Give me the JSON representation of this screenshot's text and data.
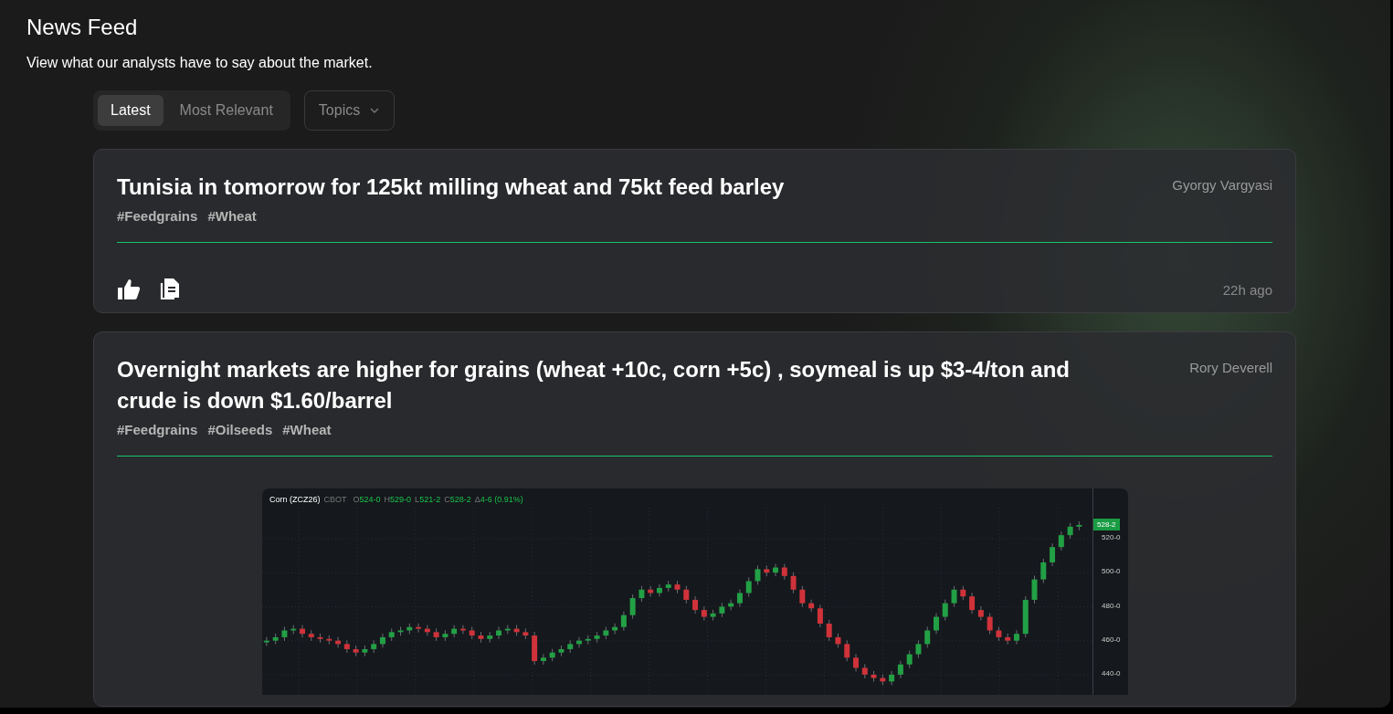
{
  "header": {
    "title": "News Feed",
    "subtitle": "View what our analysts have to say about the market."
  },
  "tabs": [
    {
      "label": "Latest",
      "selected": true
    },
    {
      "label": "Most Relevant",
      "selected": false
    }
  ],
  "topics_dropdown": {
    "label": "Topics"
  },
  "posts": [
    {
      "title": "Tunisia in tomorrow for 125kt milling wheat and 75kt feed barley",
      "author": "Gyorgy Vargyasi",
      "tags": [
        "#Feedgrains",
        "#Wheat"
      ],
      "time": "22h ago"
    },
    {
      "title": "Overnight markets are higher for grains (wheat +10c, corn +5c) , soymeal is up $3-4/ton and crude is down $1.60/barrel",
      "author": "Rory Deverell",
      "tags": [
        "#Feedgrains",
        "#Oilseeds",
        "#Wheat"
      ],
      "chart_image": {
        "symbol": "Corn (ZCZ26)",
        "exchange": "CBOT",
        "stats": [
          {
            "label": "O",
            "value": "524-0"
          },
          {
            "label": "H",
            "value": "529-0"
          },
          {
            "label": "L",
            "value": "521-2"
          },
          {
            "label": "C",
            "value": "528-2"
          },
          {
            "label": "Δ",
            "value": "4-6 (0.91%)"
          }
        ],
        "price_tag": "528-2",
        "axis_labels": [
          "520-0",
          "500-0",
          "480-0",
          "460-0",
          "440-0"
        ]
      }
    }
  ]
}
